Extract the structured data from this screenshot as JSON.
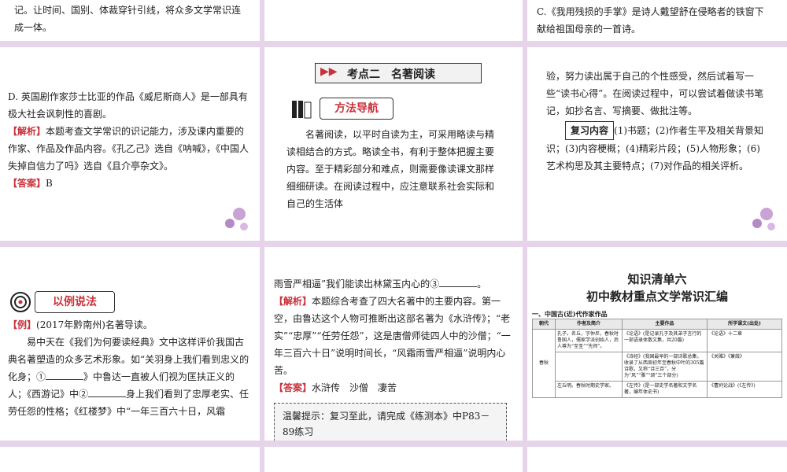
{
  "s1": {
    "text": "记。让时间、国别、体裁穿针引线，将众多文学常识连成一体。"
  },
  "s2": {
    "text": ""
  },
  "s3": {
    "text": "C.《我用残损的手掌》是诗人戴望舒在侵略者的铁窗下献给祖国母亲的一首诗。"
  },
  "s4": {
    "option_d": "D. 英国剧作家莎士比亚的作品《威尼斯商人》是一部具有极大社会讽刺性的喜剧。",
    "analysis_tag": "【解析】",
    "analysis": "本题考查文学常识的识记能力，涉及课内重要的作家、作品及作品内容。《孔乙己》选自《呐喊》，《中国人失掉自信力了吗》选自《且介亭杂文》。",
    "answer_tag": "【答案】",
    "answer": "B"
  },
  "s5": {
    "banner": "考点二　名著阅读",
    "method_title": "方法导航",
    "text": "名著阅读，以平时自读为主，可采用略读与精读相结合的方式。略读全书，有利于整体把握主要内容。至于精彩部分和难点，则需要像读课文那样细细研读。在阅读过程中，应注意联系社会实际和自己的生活体"
  },
  "s6": {
    "text": "验，努力读出属于自己的个性感受，然后试着写一些“读书心得”。在阅读过程中，可以尝试着做读书笔记，如抄名言、写摘要、做批注等。",
    "review_label": "复习内容",
    "review_text": "(1)书题；(2)作者生平及相关背景知识；(3)内容梗概；(4)精彩片段；(5)人物形象；(6)艺术构思及其主要特点；(7)对作品的相关评析。"
  },
  "s7": {
    "title": "以例说法",
    "example_tag": "【例】",
    "example_head": "(2017年黔南州)名著导读。",
    "p1": "易中天在《我们为何要读经典》文中这样评价我国古典名著塑造的众多艺术形象。如“关羽身上我们看到忠义的化身；①",
    "p2": "》中鲁达一直被人们视为匡扶正义的人；《西游记》中②",
    "p3": "身上我们看到了忠厚老实、任劳任怨的性格；《红楼梦》中“一年三百六十日，风霜"
  },
  "s8": {
    "line1": "雨雪严相逼”我们能读出林黛玉内心的③",
    "analysis_tag": "【解析】",
    "analysis": "本题综合考查了四大名著中的主要内容。第一空，由鲁达这个人物可推断出这部名著为《水浒传》；“老实”“忠厚”“任劳任怨”，这是唐僧师徒四人中的沙僧；“一年三百六十日”说明时间长，“风霜雨雪严相逼”说明内心苦。",
    "answer_tag": "【答案】",
    "answer": "水浒传　沙僧　凄苦",
    "hint": "温馨提示：复习至此，请完成《练测本》中P83－89练习"
  },
  "s9": {
    "title1": "知识清单六",
    "title2": "初中教材重点文学常识汇编",
    "section": "一、中国古(近)代作家作品",
    "headers": [
      "朝代",
      "作者及简介",
      "主要作品",
      "所学课文(出处)"
    ],
    "era": "春秋",
    "row1": [
      "孔子。名丘，字仲尼，春秋时鲁国人，儒家学派创始人，后人尊为“至圣”“先师”。",
      "《论语》(是记录孔子及其弟子言行的一部语录体散文集，共20篇)",
      "《论语》十二章"
    ],
    "row2": [
      "",
      "《诗经》(我国最早的一部诗歌总集，收录了从西周初年至春秋中叶的305篇诗歌，又称“诗三百”，分为“风”“雅”“颂”三个部分)",
      "《关雎》《蒹葭》"
    ],
    "row3": [
      "左丘明。春秋时期史学家。",
      "《左传》(是一部史学名著和文学名著，编年体史书)",
      "《曹刿论战》(《左传》)"
    ]
  }
}
